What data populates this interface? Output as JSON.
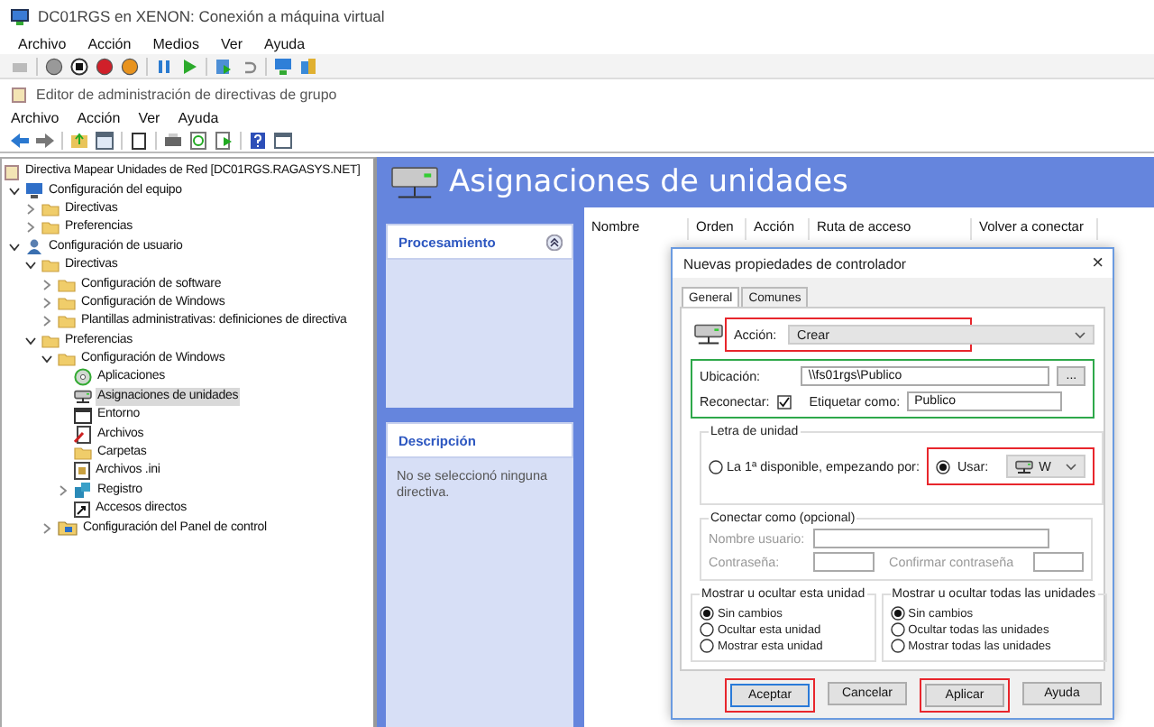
{
  "vm_window": {
    "title": "DC01RGS en XENON: Conexión a máquina virtual",
    "menu": [
      "Archivo",
      "Acción",
      "Medios",
      "Ver",
      "Ayuda"
    ]
  },
  "editor": {
    "title": "Editor de administración de directivas de grupo",
    "menu": [
      "Archivo",
      "Acción",
      "Ver",
      "Ayuda"
    ]
  },
  "tree": {
    "root": "Directiva Mapear Unidades de Red [DC01RGS.RAGASYS.NET]",
    "items": [
      {
        "label": "Configuración del equipo",
        "kind": "computer",
        "expanded": true,
        "selected": false,
        "children": [
          {
            "label": "Directivas",
            "kind": "folder",
            "expanded": false,
            "selected": false
          },
          {
            "label": "Preferencias",
            "kind": "folder",
            "expanded": false,
            "selected": false
          }
        ]
      },
      {
        "label": "Configuración de usuario",
        "kind": "user",
        "expanded": true,
        "selected": false,
        "children": [
          {
            "label": "Directivas",
            "kind": "folder",
            "expanded": true,
            "selected": false,
            "children": [
              {
                "label": "Configuración de software",
                "kind": "folder",
                "expanded": false,
                "selected": false
              },
              {
                "label": "Configuración de Windows",
                "kind": "folder",
                "expanded": false,
                "selected": false
              },
              {
                "label": "Plantillas administrativas: definiciones de directiva",
                "kind": "folder",
                "expanded": false,
                "selected": false
              }
            ]
          },
          {
            "label": "Preferencias",
            "kind": "folder",
            "expanded": true,
            "selected": false,
            "children": [
              {
                "label": "Configuración de Windows",
                "kind": "folder",
                "expanded": true,
                "selected": false,
                "children": [
                  {
                    "label": "Aplicaciones",
                    "kind": "app",
                    "selected": false
                  },
                  {
                    "label": "Asignaciones de unidades",
                    "kind": "drive",
                    "selected": true
                  },
                  {
                    "label": "Entorno",
                    "kind": "env",
                    "selected": false
                  },
                  {
                    "label": "Archivos",
                    "kind": "file",
                    "selected": false
                  },
                  {
                    "label": "Carpetas",
                    "kind": "folder",
                    "selected": false
                  },
                  {
                    "label": "Archivos .ini",
                    "kind": "ini",
                    "selected": false
                  },
                  {
                    "label": "Registro",
                    "kind": "registry",
                    "expanded": false,
                    "selected": false
                  },
                  {
                    "label": "Accesos directos",
                    "kind": "shortcut",
                    "selected": false
                  }
                ]
              },
              {
                "label": "Configuración del Panel de control",
                "kind": "panel",
                "expanded": false,
                "selected": false
              }
            ]
          }
        ]
      }
    ]
  },
  "content": {
    "title": "Asignaciones de unidades",
    "panels": [
      {
        "title": "Procesamiento"
      },
      {
        "title": "Descripción",
        "text": "No se seleccionó ninguna directiva."
      }
    ],
    "columns": [
      "Nombre",
      "Orden",
      "Acción",
      "Ruta de acceso",
      "Volver a conectar"
    ]
  },
  "dialog": {
    "title": "Nuevas propiedades de controlador",
    "close": "×",
    "tabs": [
      {
        "label": "General",
        "selected": true
      },
      {
        "label": "Comunes",
        "selected": false
      }
    ],
    "action": {
      "label": "Acción:",
      "value": "Crear",
      "highlighted": true
    },
    "location": {
      "highlighted": true,
      "label": "Ubicación:",
      "value": "\\\\fs01rgs\\Publico",
      "browse": "...",
      "reconnect_label": "Reconectar:",
      "reconnect": true,
      "label_as": "Etiquetar como:",
      "label_value": "Publico"
    },
    "drive_letter": {
      "title": "Letra de unidad",
      "options": [
        {
          "label": "La 1ª disponible, empezando por:",
          "selected": false
        },
        {
          "label": "Usar:",
          "selected": true
        }
      ],
      "drive": "W",
      "highlighted": true
    },
    "connect_as": {
      "title": "Conectar como (opcional)",
      "disabled": true,
      "user_label": "Nombre usuario:",
      "password_label": "Contraseña:",
      "confirm_label": "Confirmar contraseña"
    },
    "visibility": [
      {
        "title": "Mostrar u ocultar esta unidad",
        "options": [
          {
            "label": "Sin cambios",
            "selected": true
          },
          {
            "label": "Ocultar esta unidad",
            "selected": false
          },
          {
            "label": "Mostrar esta unidad",
            "selected": false
          }
        ]
      },
      {
        "title": "Mostrar u ocultar todas las unidades",
        "options": [
          {
            "label": "Sin cambios",
            "selected": true
          },
          {
            "label": "Ocultar todas las unidades",
            "selected": false
          },
          {
            "label": "Mostrar todas las unidades",
            "selected": false
          }
        ]
      }
    ],
    "buttons": [
      {
        "label": "Aceptar",
        "default": true,
        "highlighted": true
      },
      {
        "label": "Cancelar",
        "default": false,
        "highlighted": false
      },
      {
        "label": "Aplicar",
        "default": false,
        "highlighted": true
      },
      {
        "label": "Ayuda",
        "default": false,
        "highlighted": false
      }
    ]
  }
}
